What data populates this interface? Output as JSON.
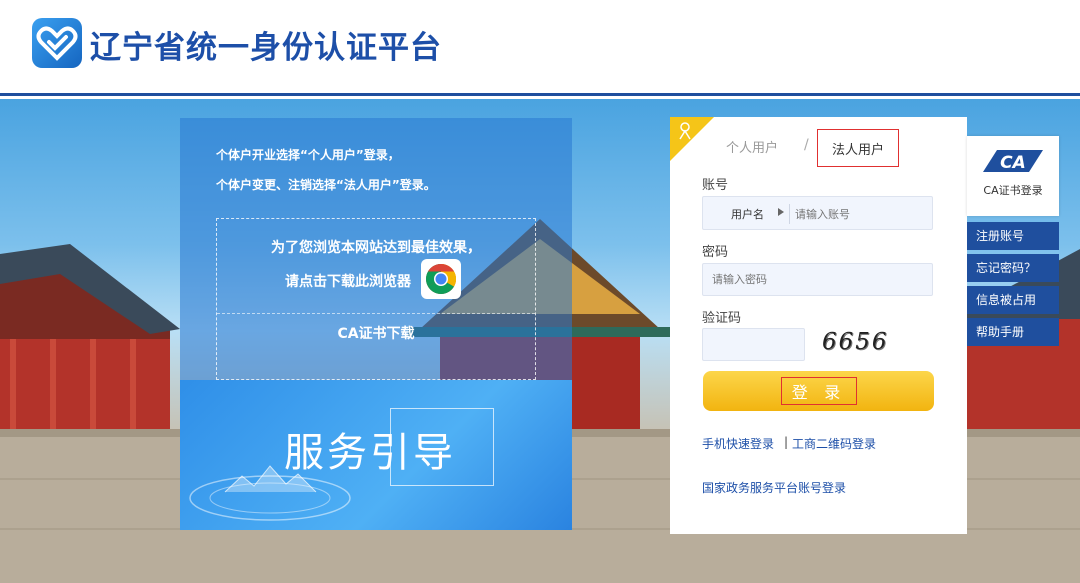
{
  "header": {
    "site_title": "辽宁省统一身份认证平台",
    "logo_icon": "heart-check-logo-icon",
    "accent_color": "#1d4fa8"
  },
  "info_panel": {
    "line1": "个体户开业选择“个人用户”登录，",
    "line2": "个体户变更、注销选择“法人用户”登录。",
    "browser_text1": "为了您浏览本网站达到最佳效果，",
    "browser_text2": "请点击下载此浏览器",
    "browser_icon": "chrome-icon",
    "ca_download": "CA证书下载",
    "guide": "服务引导"
  },
  "login": {
    "tab_personal": "个人用户",
    "tab_separator": "/",
    "tab_legal": "法人用户",
    "account_label": "账号",
    "account_type": "用户名",
    "account_placeholder": "请输入账号",
    "password_label": "密码",
    "password_placeholder": "请输入密码",
    "captcha_label": "验证码",
    "captcha_value": "6656",
    "login_button": "登 录",
    "mobile_login": "手机快速登录",
    "link_separator": "|",
    "qr_login": "工商二维码登录",
    "national_login": "国家政务服务平台账号登录",
    "button_color": "#f7c52a"
  },
  "side_menu": {
    "ca_logo": "CA",
    "ca_login": "CA证书登录",
    "items": [
      "注册账号",
      "忘记密码？",
      "信息被占用",
      "帮助手册"
    ]
  }
}
